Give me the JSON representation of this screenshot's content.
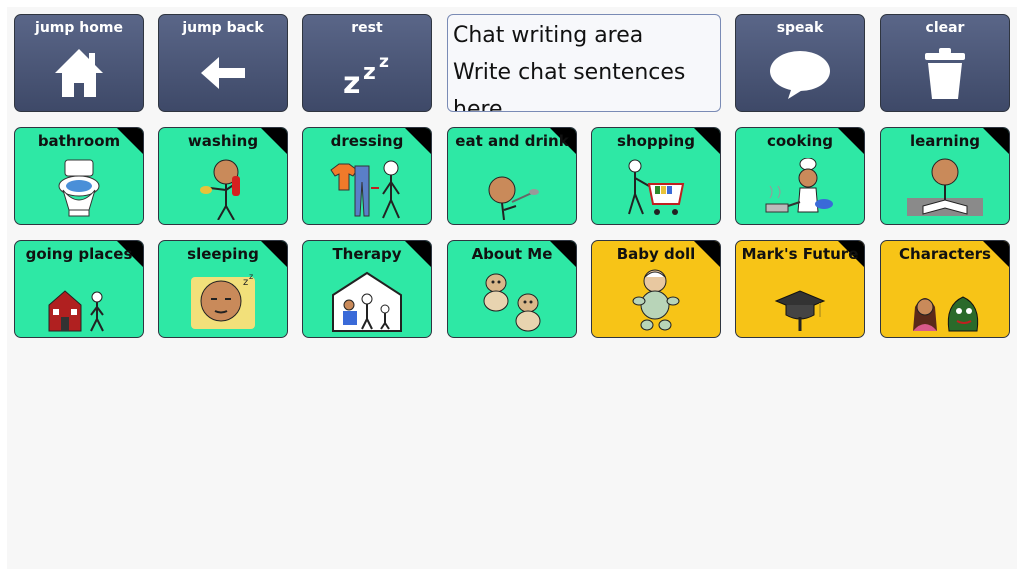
{
  "toolbar": {
    "jump_home": "jump home",
    "jump_back": "jump back",
    "rest": "rest",
    "speak": "speak",
    "clear": "clear",
    "tool_color": "#4a5578"
  },
  "chat": {
    "lines": [
      "Chat writing area",
      "Write chat sentences",
      "here"
    ]
  },
  "grid": {
    "green": "#2ee8a5",
    "yellow": "#f7c417",
    "cells": [
      {
        "label": "bathroom",
        "icon": "toilet-icon"
      },
      {
        "label": "washing",
        "icon": "person-washing-icon"
      },
      {
        "label": "dressing",
        "icon": "clothes-icon"
      },
      {
        "label": "eat and drink",
        "icon": "person-eating-icon"
      },
      {
        "label": "shopping",
        "icon": "shopping-cart-icon"
      },
      {
        "label": "cooking",
        "icon": "chef-icon"
      },
      {
        "label": "learning",
        "icon": "person-reading-icon"
      },
      {
        "label": "going places",
        "icon": "house-and-person-icon"
      },
      {
        "label": "sleeping",
        "icon": "sleeping-face-icon"
      },
      {
        "label": "Therapy",
        "icon": "family-house-icon"
      },
      {
        "label": "About Me",
        "icon": "dogs-icon"
      },
      {
        "label": "Baby doll",
        "icon": "baby-icon"
      },
      {
        "label": "Mark's Future",
        "icon": "graduation-cap-icon"
      },
      {
        "label": "Characters",
        "icon": "characters-icon"
      }
    ]
  }
}
